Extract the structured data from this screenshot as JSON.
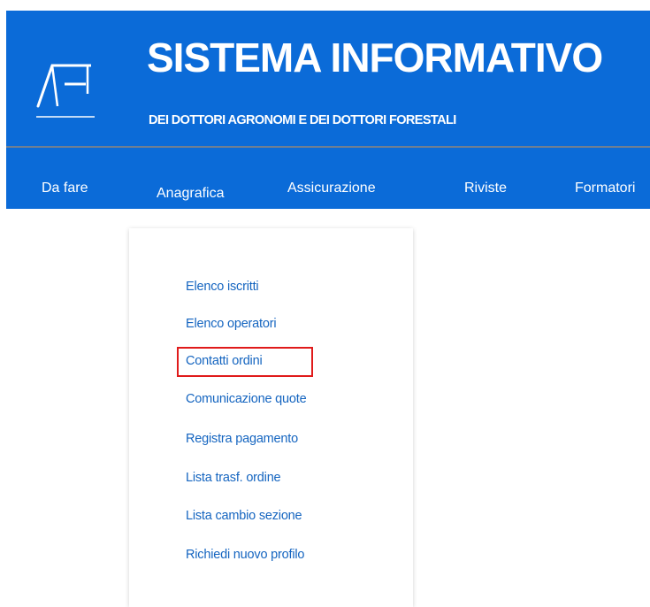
{
  "header": {
    "title": "SISTEMA INFORMATIVO",
    "subtitle": "DEI DOTTORI AGRONOMI E DEI DOTTORI FORESTALI",
    "logo_text": "AF",
    "background_color": "#0b6bd8"
  },
  "nav": {
    "items": [
      {
        "label": "Da fare"
      },
      {
        "label": "Anagrafica"
      },
      {
        "label": "Assicurazione"
      },
      {
        "label": "Riviste"
      },
      {
        "label": "Formatori"
      }
    ]
  },
  "dropdown": {
    "items": [
      {
        "label": "Elenco iscritti"
      },
      {
        "label": "Elenco operatori"
      },
      {
        "label": "Contatti ordini"
      },
      {
        "label": "Comunicazione quote"
      },
      {
        "label": "Registra pagamento"
      },
      {
        "label": "Lista trasf. ordine"
      },
      {
        "label": "Lista cambio sezione"
      },
      {
        "label": "Richiedi nuovo profilo"
      }
    ],
    "highlighted_item": "Contatti ordini",
    "highlight_color": "#e01b1b",
    "link_color": "#1565c0"
  }
}
